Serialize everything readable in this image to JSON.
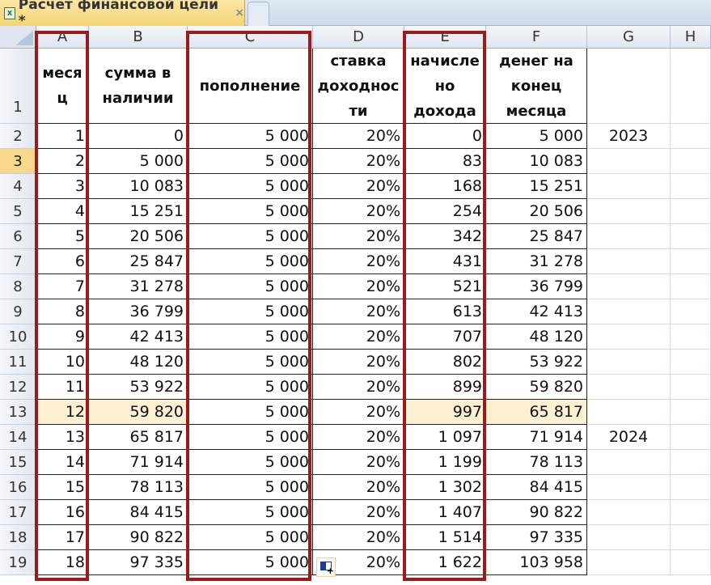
{
  "tab": {
    "title": "Расчет финансовой цели *",
    "close": "×"
  },
  "columns": [
    "A",
    "B",
    "C",
    "D",
    "E",
    "F",
    "G",
    "H"
  ],
  "header_row": [
    "меся ц",
    "сумма в наличии",
    "пополнение",
    "ставка доходнос ти",
    "начисле но дохода",
    "денег на конец месяца"
  ],
  "rows": [
    [
      "1",
      "0",
      "5 000",
      "20%",
      "0",
      "5 000",
      "2023"
    ],
    [
      "2",
      "5 000",
      "5 000",
      "20%",
      "83",
      "10 083",
      ""
    ],
    [
      "3",
      "10 083",
      "5 000",
      "20%",
      "168",
      "15 251",
      ""
    ],
    [
      "4",
      "15 251",
      "5 000",
      "20%",
      "254",
      "20 506",
      ""
    ],
    [
      "5",
      "20 506",
      "5 000",
      "20%",
      "342",
      "25 847",
      ""
    ],
    [
      "6",
      "25 847",
      "5 000",
      "20%",
      "431",
      "31 278",
      ""
    ],
    [
      "7",
      "31 278",
      "5 000",
      "20%",
      "521",
      "36 799",
      ""
    ],
    [
      "8",
      "36 799",
      "5 000",
      "20%",
      "613",
      "42 413",
      ""
    ],
    [
      "9",
      "42 413",
      "5 000",
      "20%",
      "707",
      "48 120",
      ""
    ],
    [
      "10",
      "48 120",
      "5 000",
      "20%",
      "802",
      "53 922",
      ""
    ],
    [
      "11",
      "53 922",
      "5 000",
      "20%",
      "899",
      "59 820",
      ""
    ],
    [
      "12",
      "59 820",
      "5 000",
      "20%",
      "997",
      "65 817",
      ""
    ],
    [
      "13",
      "65 817",
      "5 000",
      "20%",
      "1 097",
      "71 914",
      "2024"
    ],
    [
      "14",
      "71 914",
      "5 000",
      "20%",
      "1 199",
      "78 113",
      ""
    ],
    [
      "15",
      "78 113",
      "5 000",
      "20%",
      "1 302",
      "84 415",
      ""
    ],
    [
      "16",
      "84 415",
      "5 000",
      "20%",
      "1 407",
      "90 822",
      ""
    ],
    [
      "17",
      "90 822",
      "5 000",
      "20%",
      "1 514",
      "97 335",
      ""
    ],
    [
      "18",
      "97 335",
      "5 000",
      "20%",
      "1 622",
      "103 958",
      ""
    ]
  ],
  "row_numbers": [
    "1",
    "2",
    "3",
    "4",
    "5",
    "6",
    "7",
    "8",
    "9",
    "10",
    "11",
    "12",
    "13",
    "14",
    "15",
    "16",
    "17",
    "18",
    "19"
  ],
  "selected_row": "3",
  "highlight_row": "13"
}
